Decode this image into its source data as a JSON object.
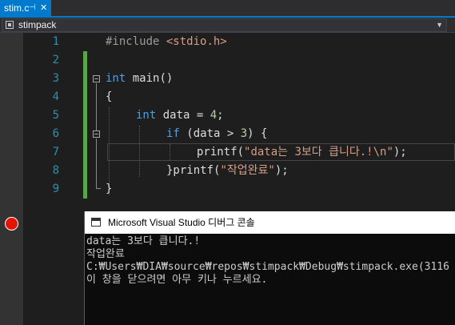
{
  "tab": {
    "title": "stim.c",
    "pin_glyph": "⊣",
    "close_glyph": "✕"
  },
  "navbar": {
    "project": "stimpack"
  },
  "lines": [
    "1",
    "2",
    "3",
    "4",
    "5",
    "6",
    "7",
    "8",
    "9"
  ],
  "code": {
    "l1_directive": "#include",
    "l1_header": "<stdio.h>",
    "l3_type": "int",
    "l3_rest": " main()",
    "l4_text": "{",
    "l5_type": "int",
    "l5_a": " data = ",
    "l5_num": "4",
    "l5_b": ";",
    "l6_kw": "if",
    "l6_a": " (data > ",
    "l6_num": "3",
    "l6_b": ") {",
    "l7_fn": "printf(",
    "l7_str": "\"data는 3보다 큽니다.!\\n\"",
    "l7_end": ");",
    "l8_a": "}printf(",
    "l8_str": "\"작업완료\"",
    "l8_b": ");",
    "l9_text": "}"
  },
  "console": {
    "title": "Microsoft Visual Studio 디버그 콘솔",
    "lines": [
      "data는 3보다 큽니다.!",
      "작업완료",
      "C:₩Users₩DIA₩source₩repos₩stimpack₩Debug₩stimpack.exe(3116",
      "이 창을 닫으려면 아무 키나 누르세요."
    ]
  },
  "colors": {
    "keyword": "#569cd6",
    "string": "#d69d85",
    "number": "#b5cea8",
    "line_number": "#2b91af",
    "breakpoint": "#e51400",
    "change_bar": "#57a64a",
    "accent": "#007acc"
  }
}
